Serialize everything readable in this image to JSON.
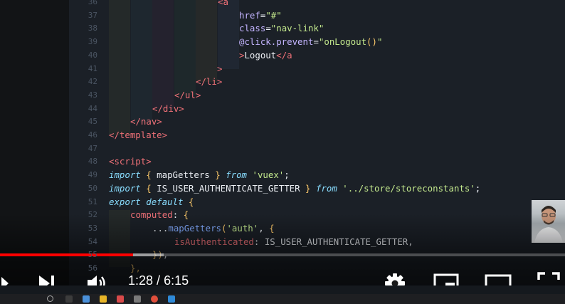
{
  "editor": {
    "lines": [
      {
        "n": "37",
        "tokens": [
          [
            "t-attr",
            "href"
          ],
          [
            "t-plain",
            "="
          ],
          [
            "t-str",
            "\"#\""
          ]
        ],
        "indent": 183
      },
      {
        "n": "38",
        "tokens": [
          [
            "t-attr",
            "class"
          ],
          [
            "t-plain",
            "="
          ],
          [
            "t-str",
            "\"nav-link\""
          ]
        ],
        "indent": 183
      },
      {
        "n": "39",
        "tokens": [
          [
            "t-attr",
            "@click.prevent"
          ],
          [
            "t-plain",
            "="
          ],
          [
            "t-str",
            "\"onLogout"
          ],
          [
            "t-br",
            "()"
          ],
          [
            "t-str",
            "\""
          ]
        ],
        "indent": 183
      },
      {
        "n": "40",
        "tokens": [
          [
            "t-tag",
            ">"
          ],
          [
            "t-plain",
            "Logout"
          ],
          [
            "t-tag",
            "</a"
          ]
        ],
        "indent": 183
      },
      {
        "n": "41",
        "tokens": [
          [
            "t-tag",
            ">"
          ]
        ],
        "indent": 152
      },
      {
        "n": "42",
        "tokens": [
          [
            "t-tag",
            "</li>"
          ]
        ],
        "indent": 122
      },
      {
        "n": "43",
        "tokens": [
          [
            "t-tag",
            "</ul>"
          ]
        ],
        "indent": 92
      },
      {
        "n": "44",
        "tokens": [
          [
            "t-tag",
            "</div>"
          ]
        ],
        "indent": 61
      },
      {
        "n": "45",
        "tokens": [
          [
            "t-tag",
            "</nav>"
          ]
        ],
        "indent": 30
      },
      {
        "n": "46",
        "tokens": [
          [
            "t-tag",
            "</template>"
          ]
        ],
        "indent": 0
      },
      {
        "n": "47",
        "tokens": [],
        "indent": 0
      },
      {
        "n": "48",
        "tokens": [
          [
            "t-tag",
            "<script>"
          ]
        ],
        "indent": 0
      },
      {
        "n": "49",
        "tokens": [
          [
            "t-kw",
            "import"
          ],
          [
            "t-plain",
            " "
          ],
          [
            "t-br",
            "{"
          ],
          [
            "t-plain",
            " mapGetters "
          ],
          [
            "t-br",
            "}"
          ],
          [
            "t-plain",
            " "
          ],
          [
            "t-kw",
            "from"
          ],
          [
            "t-plain",
            " "
          ],
          [
            "t-str",
            "'vuex'"
          ],
          [
            "t-plain",
            ";"
          ]
        ],
        "indent": 0
      },
      {
        "n": "50",
        "tokens": [
          [
            "t-kw",
            "import"
          ],
          [
            "t-plain",
            " "
          ],
          [
            "t-br",
            "{"
          ],
          [
            "t-plain",
            " IS_USER_AUTHENTICATE_GETTER "
          ],
          [
            "t-br",
            "}"
          ],
          [
            "t-plain",
            " "
          ],
          [
            "t-kw",
            "from"
          ],
          [
            "t-plain",
            " "
          ],
          [
            "t-str",
            "'../store/storeconstants'"
          ],
          [
            "t-plain",
            ";"
          ]
        ],
        "indent": 0
      },
      {
        "n": "51",
        "tokens": [
          [
            "t-kw",
            "export"
          ],
          [
            "t-plain",
            " "
          ],
          [
            "t-kw",
            "default"
          ],
          [
            "t-plain",
            " "
          ],
          [
            "t-br",
            "{"
          ]
        ],
        "indent": 0
      },
      {
        "n": "52",
        "tokens": [
          [
            "t-tag",
            "computed"
          ],
          [
            "t-plain",
            ": "
          ],
          [
            "t-br",
            "{"
          ]
        ],
        "indent": 30
      },
      {
        "n": "53",
        "tokens": [
          [
            "t-plain",
            "..."
          ],
          [
            "t-fn",
            "mapGetters"
          ],
          [
            "t-br",
            "("
          ],
          [
            "t-str",
            "'auth'"
          ],
          [
            "t-plain",
            ", "
          ],
          [
            "t-br",
            "{"
          ]
        ],
        "indent": 61
      },
      {
        "n": "54",
        "tokens": [
          [
            "t-tag",
            "isAuthenticated"
          ],
          [
            "t-plain",
            ": IS_USER_AUTHENTICATE_GETTER,"
          ]
        ],
        "indent": 92
      },
      {
        "n": "55",
        "tokens": [
          [
            "t-br",
            "})"
          ],
          [
            "t-plain",
            ","
          ]
        ],
        "indent": 61
      },
      {
        "n": "56",
        "tokens": [
          [
            "t-br",
            "},"
          ]
        ],
        "indent": 30
      }
    ],
    "top_partial": {
      "n": "36",
      "text": "<a"
    }
  },
  "player": {
    "time_current": "1:28",
    "time_sep": " / ",
    "time_total": "6:15",
    "progress": 0.235,
    "loaded": 0.29
  },
  "colors": {
    "progress": "#ff0000",
    "bg": "#1b2027"
  }
}
